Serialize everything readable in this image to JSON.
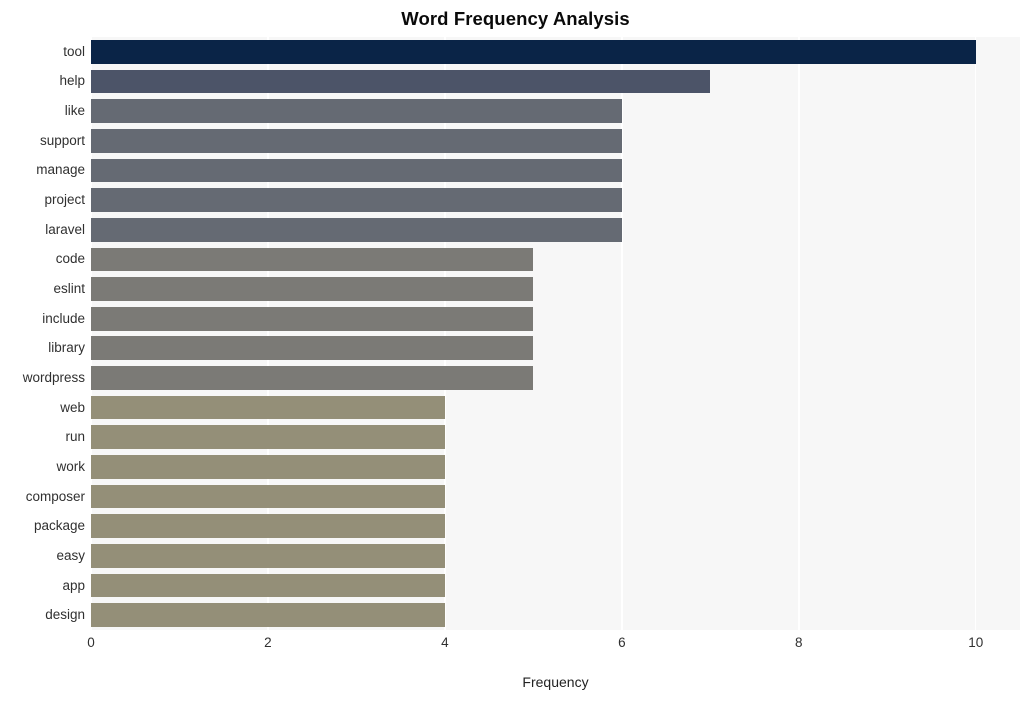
{
  "chart_data": {
    "type": "bar",
    "orientation": "horizontal",
    "title": "Word Frequency Analysis",
    "xlabel": "Frequency",
    "ylabel": "",
    "categories": [
      "tool",
      "help",
      "like",
      "support",
      "manage",
      "project",
      "laravel",
      "code",
      "eslint",
      "include",
      "library",
      "wordpress",
      "web",
      "run",
      "work",
      "composer",
      "package",
      "easy",
      "app",
      "design"
    ],
    "values": [
      10,
      7,
      6,
      6,
      6,
      6,
      6,
      5,
      5,
      5,
      5,
      5,
      4,
      4,
      4,
      4,
      4,
      4,
      4,
      4
    ],
    "bar_colors": [
      "#0a2447",
      "#4c5468",
      "#656a73",
      "#656a73",
      "#656a73",
      "#656a73",
      "#656a73",
      "#7b7a76",
      "#7b7a76",
      "#7b7a76",
      "#7b7a76",
      "#7b7a76",
      "#948f78",
      "#948f78",
      "#948f78",
      "#948f78",
      "#948f78",
      "#948f78",
      "#948f78",
      "#948f78"
    ],
    "xticks": [
      0,
      2,
      4,
      6,
      8,
      10
    ],
    "xtick_labels": [
      "0",
      "2",
      "4",
      "6",
      "8",
      "10"
    ],
    "xlim": [
      0,
      10.5
    ],
    "grid": true,
    "grid_axis": "x",
    "grid_color": "#ffffff",
    "plot_background": "#f7f7f7",
    "figure_background": "#ffffff",
    "legend": null
  }
}
